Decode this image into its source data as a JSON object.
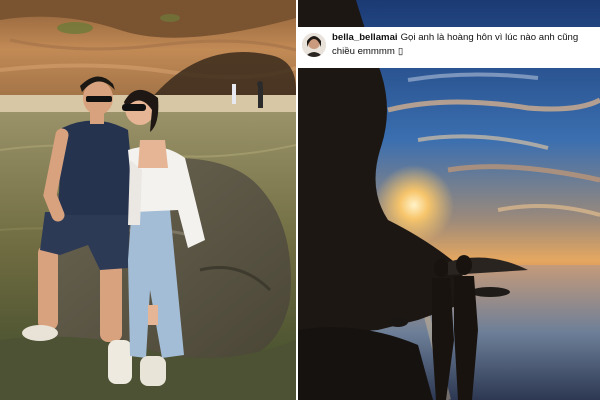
{
  "post": {
    "username": "bella_bellamai",
    "caption": "Gọi anh là hoàng hôn vì lúc nào anh cũng chiều emmmm",
    "emoji": "▯"
  },
  "colors": {
    "cliff_left": "#b08052",
    "sea_left": "#7a7347",
    "sky_top": "#1e3f78",
    "sunset": "#f2c77e",
    "silhouette": "#15110e"
  }
}
